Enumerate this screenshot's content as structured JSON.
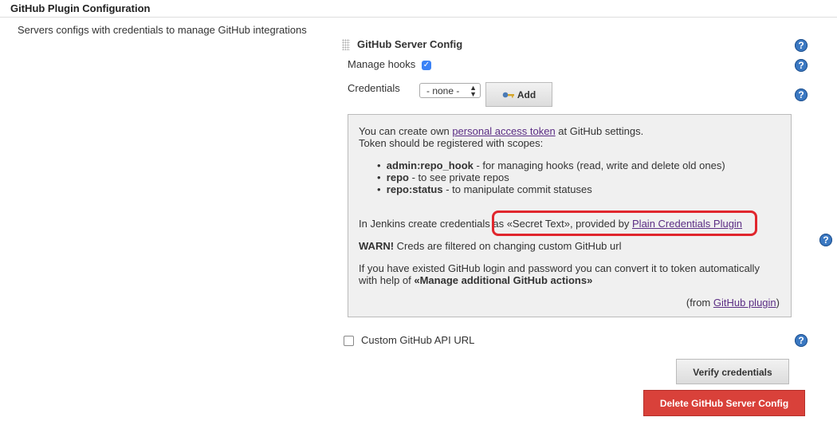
{
  "section": {
    "title": "GitHub Plugin Configuration",
    "description": "Servers configs with credentials to manage GitHub integrations"
  },
  "server_config": {
    "title": "GitHub Server Config",
    "manage_hooks_label": "Manage hooks",
    "manage_hooks_checked": true,
    "credentials_label": "Credentials",
    "credentials_selected": "- none -",
    "add_button": "Add",
    "custom_api_label": "Custom GitHub API URL",
    "custom_api_checked": false,
    "verify_button": "Verify credentials",
    "delete_button": "Delete GitHub Server Config"
  },
  "help": {
    "line1_prefix": "You can create own ",
    "line1_link": "personal access token",
    "line1_suffix": " at GitHub settings.",
    "line2": "Token should be registered with scopes:",
    "scopes": [
      {
        "name": "admin:repo_hook",
        "desc": " - for managing hooks (read, write and delete old ones)"
      },
      {
        "name": "repo",
        "desc": " - to see private repos"
      },
      {
        "name": "repo:status",
        "desc": " - to manipulate commit statuses"
      }
    ],
    "jenkins_prefix": "In Jenkins create credentials as «Secret Text», provided by ",
    "jenkins_link": "Plain Credentials Plugin",
    "warn_bold": "WARN!",
    "warn_text": " Creds are filtered on changing custom GitHub url",
    "convert_line1": "If you have existed GitHub login and password you can convert it to token automatically",
    "convert_line2_prefix": "with help of ",
    "convert_bold": "«Manage additional GitHub actions»",
    "from_prefix": "(from ",
    "from_link": "GitHub plugin",
    "from_suffix": ")"
  },
  "colors": {
    "help_icon": "#3a78c2",
    "delete_button": "#d9413a",
    "highlight": "#e0262d",
    "link": "#5b2d84"
  },
  "icons": {
    "help": "help-circle-icon",
    "key": "key-icon",
    "drag": "drag-handle-icon"
  }
}
